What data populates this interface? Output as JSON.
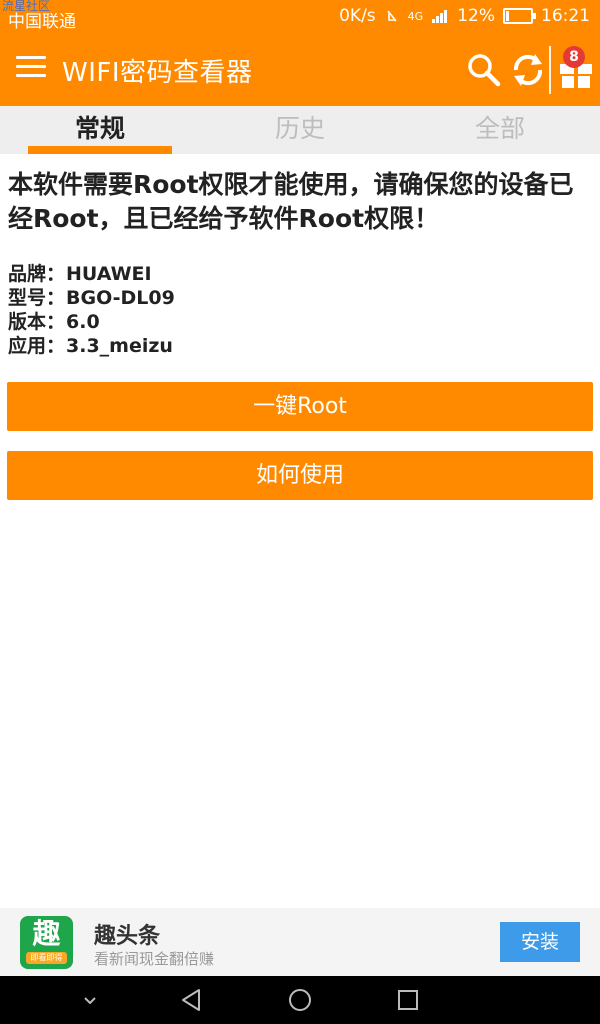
{
  "status": {
    "watermark": "流星社区",
    "carrier": "中国联通",
    "speed": "0K/s",
    "network": "4G",
    "battery": "12%",
    "battery_level": 0.12,
    "time": "16:21"
  },
  "appbar": {
    "title": "WIFI密码查看器",
    "badge_count": "8",
    "icons": [
      "menu-icon",
      "search-icon",
      "refresh-icon",
      "gift-icon"
    ]
  },
  "tabs": [
    {
      "label": "常规",
      "active": true
    },
    {
      "label": "历史",
      "active": false
    },
    {
      "label": "全部",
      "active": false
    }
  ],
  "main": {
    "warning": "本软件需要Root权限才能使用，请确保您的设备已经Root，且已经给予软件Root权限！",
    "info": [
      {
        "key": "品牌：",
        "value": "HUAWEI"
      },
      {
        "key": "型号：",
        "value": "BGO-DL09"
      },
      {
        "key": "版本：",
        "value": "6.0"
      },
      {
        "key": "应用：",
        "value": "3.3_meizu"
      }
    ],
    "root_button": "一键Root",
    "howto_button": "如何使用"
  },
  "ad": {
    "logo_char": "趣",
    "logo_caption": "即看即得",
    "title": "趣头条",
    "subtitle": "看新闻现金翻倍赚",
    "install_button": "安装"
  },
  "colors": {
    "accent": "#ff8a00",
    "tab_bg": "#eeeeee",
    "install": "#3d9be9"
  }
}
